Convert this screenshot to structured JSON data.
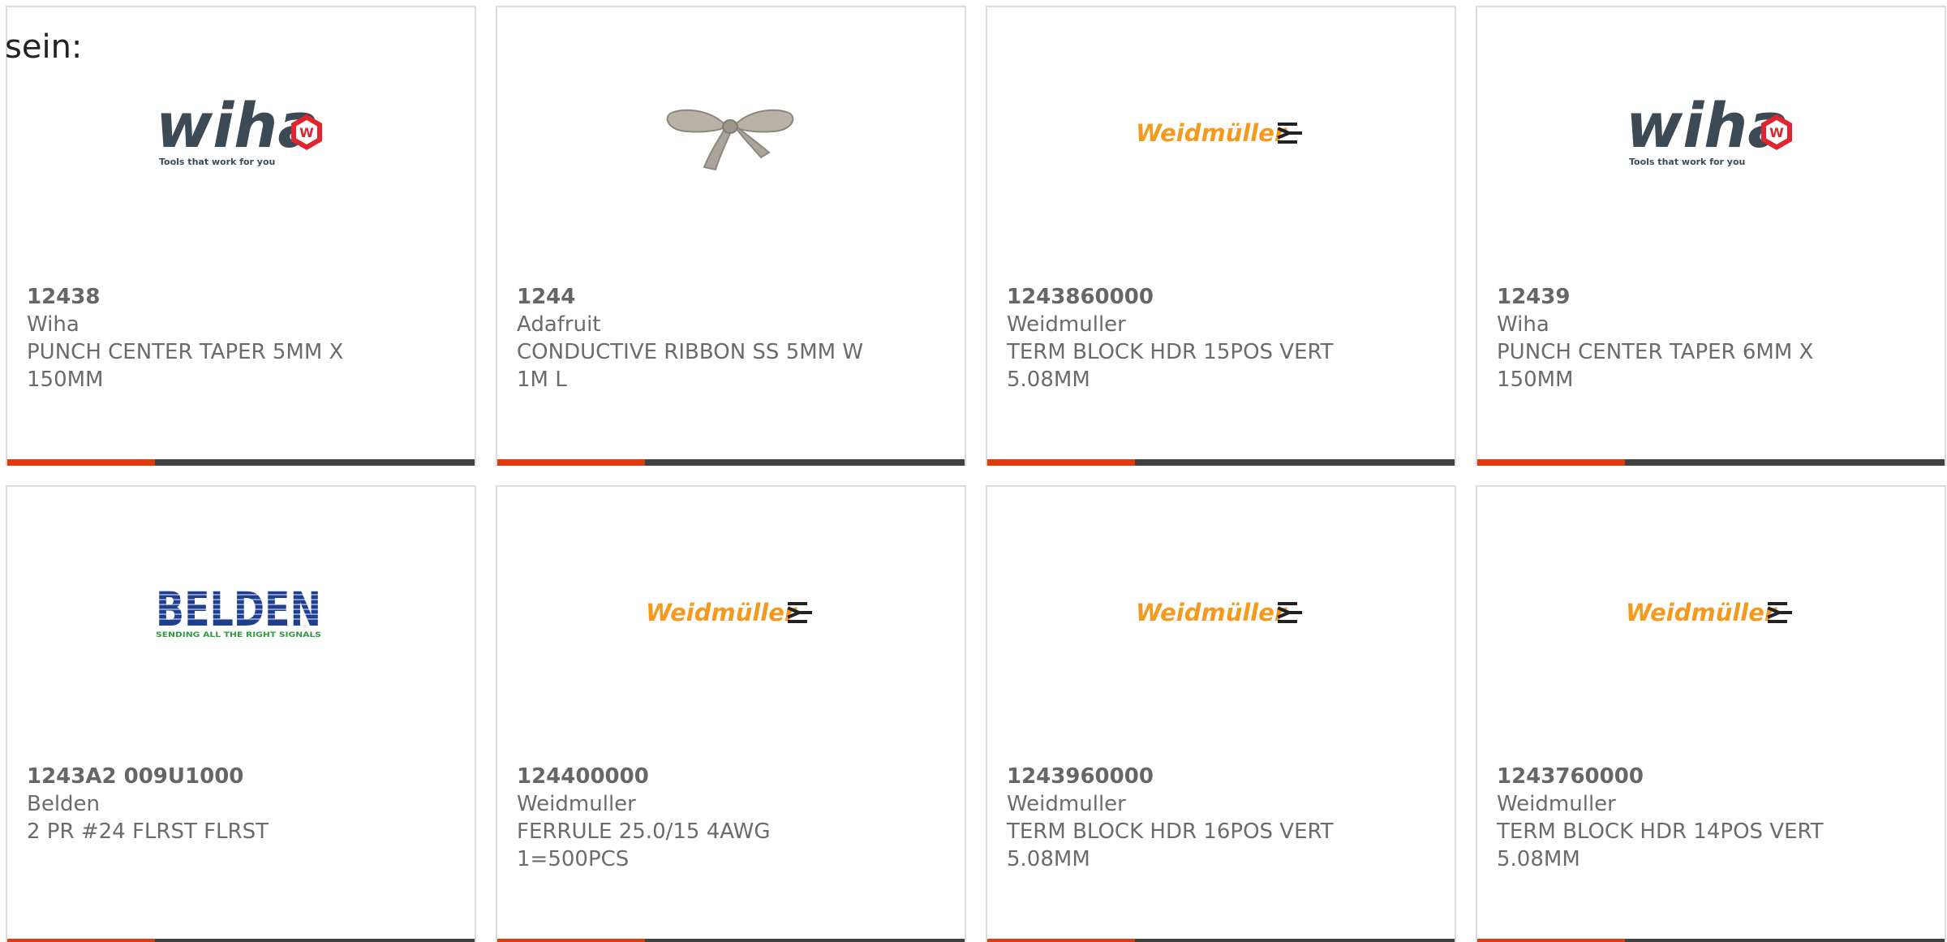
{
  "page": {
    "top_label": "sein:"
  },
  "products": [
    {
      "part_number": "12438",
      "manufacturer": "Wiha",
      "description_line1": "PUNCH CENTER TAPER 5MM X",
      "description_line2": "150MM",
      "logo": {
        "type": "wiha",
        "text": "wiha",
        "tagline": "Tools that work for you",
        "badge": "W"
      }
    },
    {
      "part_number": "1244",
      "manufacturer": "Adafruit",
      "description_line1": "CONDUCTIVE RIBBON SS 5MM W",
      "description_line2": "1M L",
      "logo": {
        "type": "ribbon-photo"
      }
    },
    {
      "part_number": "1243860000",
      "manufacturer": "Weidmuller",
      "description_line1": "TERM BLOCK HDR 15POS VERT",
      "description_line2": "5.08MM",
      "logo": {
        "type": "weidmuller",
        "text": "Weidmüller"
      }
    },
    {
      "part_number": "12439",
      "manufacturer": "Wiha",
      "description_line1": "PUNCH CENTER TAPER 6MM X",
      "description_line2": "150MM",
      "logo": {
        "type": "wiha",
        "text": "wiha",
        "tagline": "Tools that work for you",
        "badge": "W"
      }
    },
    {
      "part_number": "1243A2 009U1000",
      "manufacturer": "Belden",
      "description_line1": "2 PR #24 FLRST FLRST",
      "description_line2": "",
      "logo": {
        "type": "belden",
        "text": "BELDEN",
        "tagline": "SENDING ALL THE RIGHT SIGNALS"
      }
    },
    {
      "part_number": "124400000",
      "manufacturer": "Weidmuller",
      "description_line1": "FERRULE 25.0/15 4AWG",
      "description_line2": "1=500PCS",
      "logo": {
        "type": "weidmuller",
        "text": "Weidmüller"
      }
    },
    {
      "part_number": "1243960000",
      "manufacturer": "Weidmuller",
      "description_line1": "TERM BLOCK HDR 16POS VERT",
      "description_line2": "5.08MM",
      "logo": {
        "type": "weidmuller",
        "text": "Weidmüller"
      }
    },
    {
      "part_number": "1243760000",
      "manufacturer": "Weidmuller",
      "description_line1": "TERM BLOCK HDR 14POS VERT",
      "description_line2": "5.08MM",
      "logo": {
        "type": "weidmuller",
        "text": "Weidmüller"
      }
    }
  ],
  "colors": {
    "accent": "#e03a0e",
    "bar": "#414141",
    "text": "#6b6b6b",
    "border": "#dcdcdc",
    "weidmuller_orange": "#f39a1f",
    "wiha_slate": "#3c4a55",
    "wiha_red": "#e0252e",
    "belden_blue": "#1e3e8f",
    "belden_green": "#2e9b3e"
  }
}
